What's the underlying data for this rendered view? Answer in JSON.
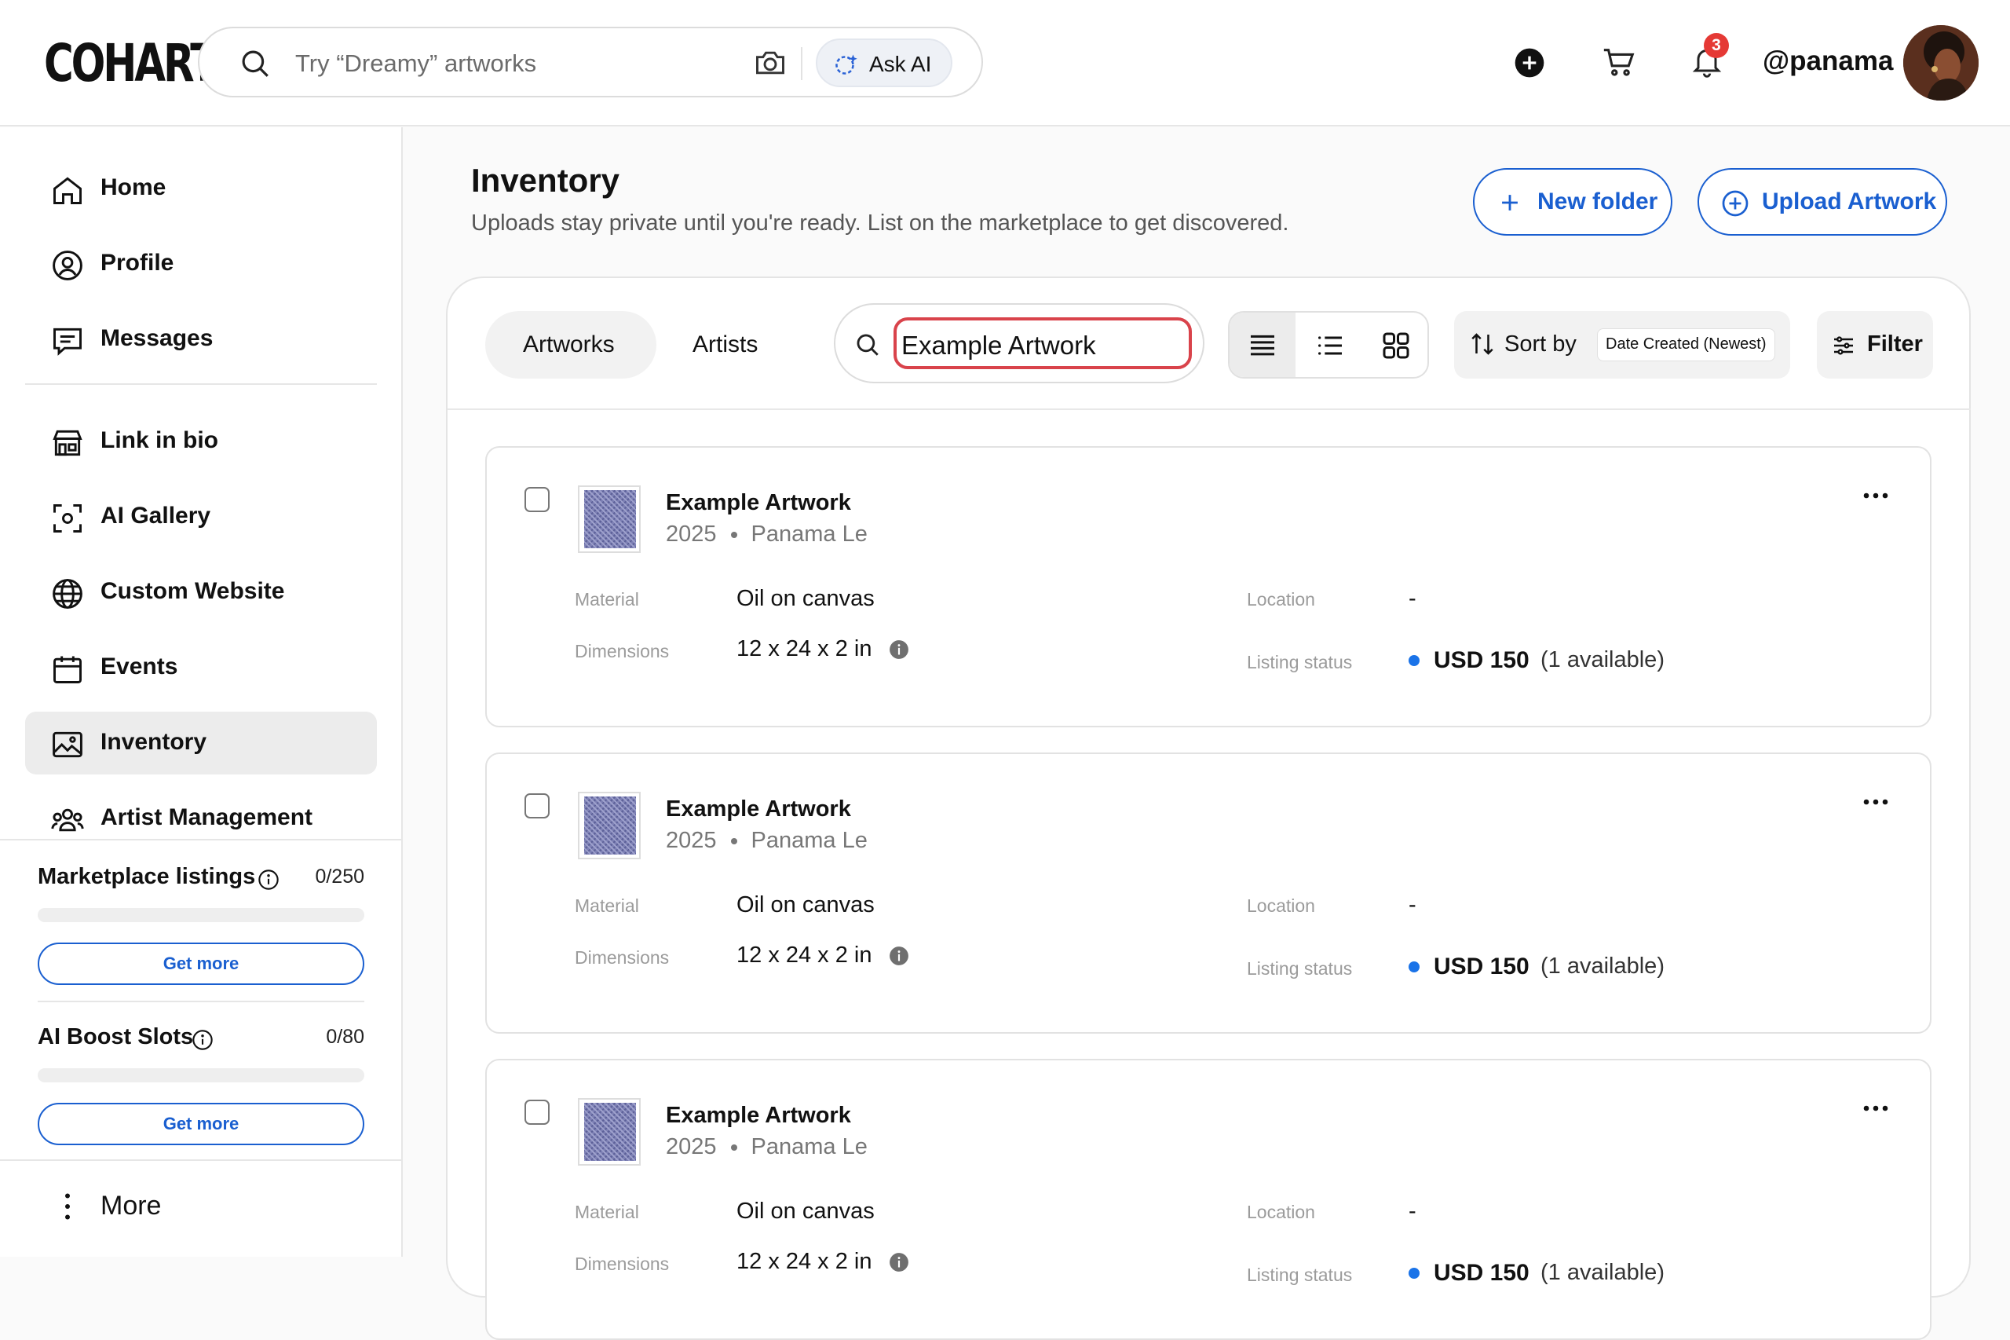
{
  "header": {
    "logo": "COHART",
    "search_placeholder": "Try “Dreamy” artworks",
    "ask_ai_label": "Ask AI",
    "notification_count": "3",
    "username": "@panama"
  },
  "sidebar": {
    "nav_items": [
      {
        "label": "Home",
        "icon": "home-icon"
      },
      {
        "label": "Profile",
        "icon": "profile-icon"
      },
      {
        "label": "Messages",
        "icon": "messages-icon"
      },
      {
        "label": "Link in bio",
        "icon": "storefront-icon"
      },
      {
        "label": "AI Gallery",
        "icon": "ai-gallery-icon"
      },
      {
        "label": "Custom Website",
        "icon": "globe-icon"
      },
      {
        "label": "Events",
        "icon": "calendar-icon"
      },
      {
        "label": "Inventory",
        "icon": "image-icon",
        "active": true
      },
      {
        "label": "Artist Management",
        "icon": "people-icon"
      }
    ],
    "marketplace": {
      "label": "Marketplace listings",
      "value": "0/250",
      "used_fraction": 0,
      "button": "Get more"
    },
    "ai_boost": {
      "label": "AI Boost Slots",
      "value": "0/80",
      "used_fraction": 0,
      "button": "Get more"
    },
    "more_label": "More"
  },
  "main": {
    "title": "Inventory",
    "subtitle": "Uploads stay private until you're ready. List on the marketplace to get discovered.",
    "new_folder_label": "New folder",
    "upload_label": "Upload Artwork",
    "tabs": [
      {
        "label": "Artworks",
        "active": true
      },
      {
        "label": "Artists",
        "active": false
      }
    ],
    "search_value": "Example Artwork",
    "view_modes": [
      "compact-list-icon",
      "list-icon",
      "grid-icon"
    ],
    "sort_label": "Sort by",
    "sort_value": "Date Created (Newest)",
    "filter_label": "Filter"
  },
  "field_labels": {
    "material": "Material",
    "dimensions": "Dimensions",
    "location": "Location",
    "listing_status": "Listing status"
  },
  "artworks": [
    {
      "title": "Example Artwork",
      "year": "2025",
      "artist": "Panama Le",
      "material": "Oil on canvas",
      "dimensions": "12 x 24 x 2 in",
      "location": "-",
      "price": "USD 150",
      "availability": "(1 available)"
    },
    {
      "title": "Example Artwork",
      "year": "2025",
      "artist": "Panama Le",
      "material": "Oil on canvas",
      "dimensions": "12 x 24 x 2 in",
      "location": "-",
      "price": "USD 150",
      "availability": "(1 available)"
    },
    {
      "title": "Example Artwork",
      "year": "2025",
      "artist": "Panama Le",
      "material": "Oil on canvas",
      "dimensions": "12 x 24 x 2 in",
      "location": "-",
      "price": "USD 150",
      "availability": "(1 available)"
    }
  ],
  "colors": {
    "accent": "#1a5fd0",
    "badge": "#e53935",
    "search_highlight": "#d9434b",
    "status_dot": "#1a73e8"
  }
}
